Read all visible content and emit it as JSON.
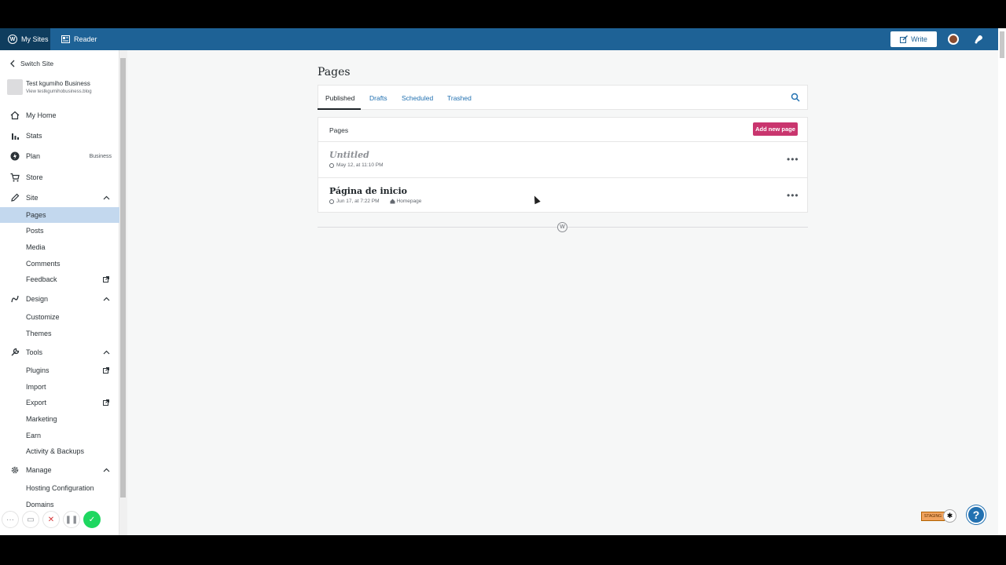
{
  "masterbar": {
    "my_sites": "My Sites",
    "reader": "Reader",
    "write": "Write"
  },
  "sidebar": {
    "switch_site": "Switch Site",
    "site_name": "Test kgumiho Business",
    "site_url": "View testkgumihobusiness.blog",
    "items": {
      "my_home": "My Home",
      "stats": "Stats",
      "plan": "Plan",
      "plan_badge": "Business",
      "store": "Store",
      "site": "Site",
      "pages": "Pages",
      "posts": "Posts",
      "media": "Media",
      "comments": "Comments",
      "feedback": "Feedback",
      "design": "Design",
      "customize": "Customize",
      "themes": "Themes",
      "tools": "Tools",
      "plugins": "Plugins",
      "import": "Import",
      "export": "Export",
      "marketing": "Marketing",
      "earn": "Earn",
      "activity": "Activity & Backups",
      "manage": "Manage",
      "hosting": "Hosting Configuration",
      "domains": "Domains"
    }
  },
  "main": {
    "title": "Pages",
    "tabs": [
      "Published",
      "Drafts",
      "Scheduled",
      "Trashed"
    ],
    "list_header": "Pages",
    "add_new": "Add new page",
    "pages": [
      {
        "title": "Untitled",
        "date": "May 12, at 11:10 PM"
      },
      {
        "title": "Página de inicio",
        "date": "Jun 17, at 7:22 PM",
        "badge": "Homepage"
      }
    ]
  },
  "widgets": {
    "staging": "STAGING",
    "help": "?"
  },
  "colors": {
    "masterbar": "#1e6296",
    "accent": "#c9356e",
    "link": "#2271b1",
    "selected_nav": "#c3d8ee"
  }
}
